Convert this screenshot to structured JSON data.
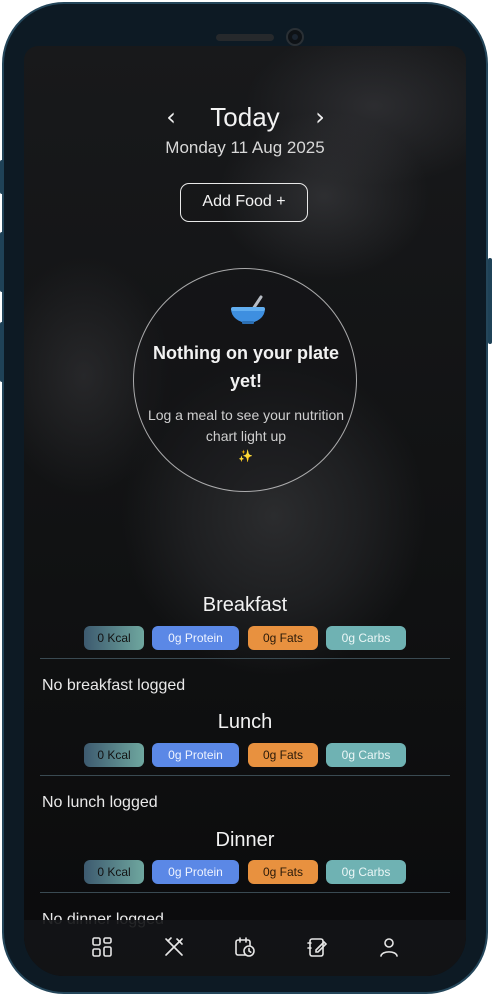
{
  "header": {
    "title": "Today",
    "date": "Monday 11 Aug 2025",
    "prev_icon": "chevron-left-icon",
    "next_icon": "chevron-right-icon"
  },
  "add_food": {
    "label": "Add Food  +"
  },
  "empty_state": {
    "icon": "bowl-icon",
    "title": "Nothing on your plate yet!",
    "description": "Log a meal to see your nutrition chart light up",
    "sparkle": "✨"
  },
  "meals": [
    {
      "name": "Breakfast",
      "kcal": "0 Kcal",
      "protein": "0g Protein",
      "fats": "0g Fats",
      "carbs": "0g Carbs",
      "empty": "No breakfast logged"
    },
    {
      "name": "Lunch",
      "kcal": "0 Kcal",
      "protein": "0g Protein",
      "fats": "0g Fats",
      "carbs": "0g Carbs",
      "empty": "No lunch logged"
    },
    {
      "name": "Dinner",
      "kcal": "0 Kcal",
      "protein": "0g Protein",
      "fats": "0g Fats",
      "carbs": "0g Carbs",
      "empty": "No dinner logged"
    }
  ],
  "bottom_nav": {
    "items": [
      "dashboard-icon",
      "utensils-icon",
      "calendar-clock-icon",
      "notes-icon",
      "profile-icon"
    ]
  },
  "colors": {
    "protein": "#5b88e6",
    "fats": "#e8913f",
    "carbs": "#6fb2b3",
    "frame": "#24465a"
  }
}
